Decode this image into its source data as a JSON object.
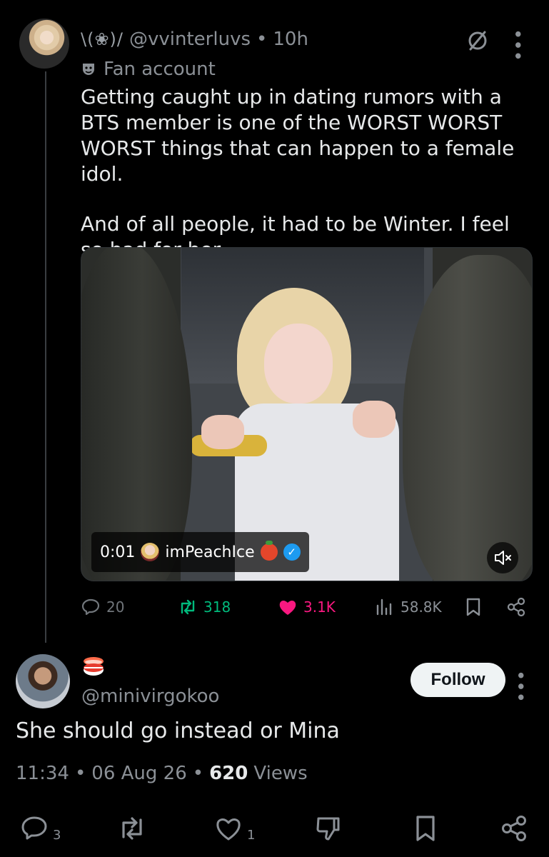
{
  "tweet": {
    "decoration": "\\(❀)/",
    "handle": "@vvinterluvs",
    "separator": "•",
    "time_ago": "10h",
    "label": "Fan account",
    "paragraph_1": "Getting caught up in dating rumors with a BTS member is one of the WORST WORST WORST things that can happen to a female idol.",
    "paragraph_2": "And of all people, it had to be Winter. I feel so bad for her.",
    "video": {
      "timestamp": "0:01",
      "account": "imPeachIce"
    },
    "stats": {
      "replies": "20",
      "reposts": "318",
      "likes": "3.1K",
      "views": "58.8K"
    }
  },
  "reply": {
    "handle": "@minivirgokoo",
    "follow_label": "Follow",
    "text": "She should go instead or Mina",
    "time": "11:34",
    "separator": "•",
    "date": "06 Aug 26",
    "views_count": "620",
    "views_label": "Views",
    "stats": {
      "replies": "3",
      "likes": "1"
    }
  },
  "colors": {
    "background": "#000000",
    "muted": "#8b9096",
    "repost": "#00ba7c",
    "like": "#f91880",
    "verified": "#1d9bf0"
  }
}
